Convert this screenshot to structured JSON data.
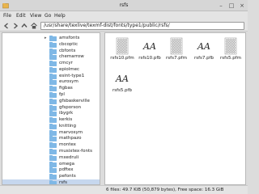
{
  "window": {
    "title": "rsfs"
  },
  "menu": {
    "file": "File",
    "edit": "Edit",
    "view": "View",
    "go": "Go",
    "help": "Help"
  },
  "location": {
    "path": "/usr/share/texlive/texmf-dist/fonts/type1/public/rsfs/"
  },
  "sidebar": {
    "items": [
      {
        "label": "amsfonts",
        "expander": "▸"
      },
      {
        "label": "cbcoptic",
        "expander": ""
      },
      {
        "label": "cbfonts",
        "expander": ""
      },
      {
        "label": "chemarrow",
        "expander": ""
      },
      {
        "label": "cmcyr",
        "expander": ""
      },
      {
        "label": "epiolmec",
        "expander": ""
      },
      {
        "label": "esint-type1",
        "expander": ""
      },
      {
        "label": "eurosym",
        "expander": ""
      },
      {
        "label": "figbas",
        "expander": ""
      },
      {
        "label": "fpl",
        "expander": ""
      },
      {
        "label": "gfsbaskerville",
        "expander": ""
      },
      {
        "label": "gfsporson",
        "expander": ""
      },
      {
        "label": "ibygrk",
        "expander": ""
      },
      {
        "label": "kerkis",
        "expander": ""
      },
      {
        "label": "knitting",
        "expander": ""
      },
      {
        "label": "marvosym",
        "expander": ""
      },
      {
        "label": "mathpazo",
        "expander": ""
      },
      {
        "label": "montex",
        "expander": ""
      },
      {
        "label": "musixtex-fonts",
        "expander": ""
      },
      {
        "label": "mxedruli",
        "expander": ""
      },
      {
        "label": "omega",
        "expander": ""
      },
      {
        "label": "pdftex",
        "expander": ""
      },
      {
        "label": "pefonts",
        "expander": ""
      },
      {
        "label": "rsfs",
        "expander": "",
        "selected": true
      }
    ]
  },
  "files": [
    {
      "name": "rsfs10.pfm",
      "kind": "pfm"
    },
    {
      "name": "rsfs10.pfb",
      "kind": "pfb",
      "glyph": "AA"
    },
    {
      "name": "rsfs7.pfm",
      "kind": "pfm"
    },
    {
      "name": "rsfs7.pfb",
      "kind": "pfb",
      "glyph": "AA"
    },
    {
      "name": "rsfs5.pfm",
      "kind": "pfm"
    },
    {
      "name": "rsfs5.pfb",
      "kind": "pfb",
      "glyph": "AA"
    }
  ],
  "status": {
    "text": "6 files: 49.7  KiB (50,879 bytes), Free space: 16.3  GiB"
  },
  "colors": {
    "folder": "#7fb8e6",
    "selection": "#c6d7ee"
  }
}
